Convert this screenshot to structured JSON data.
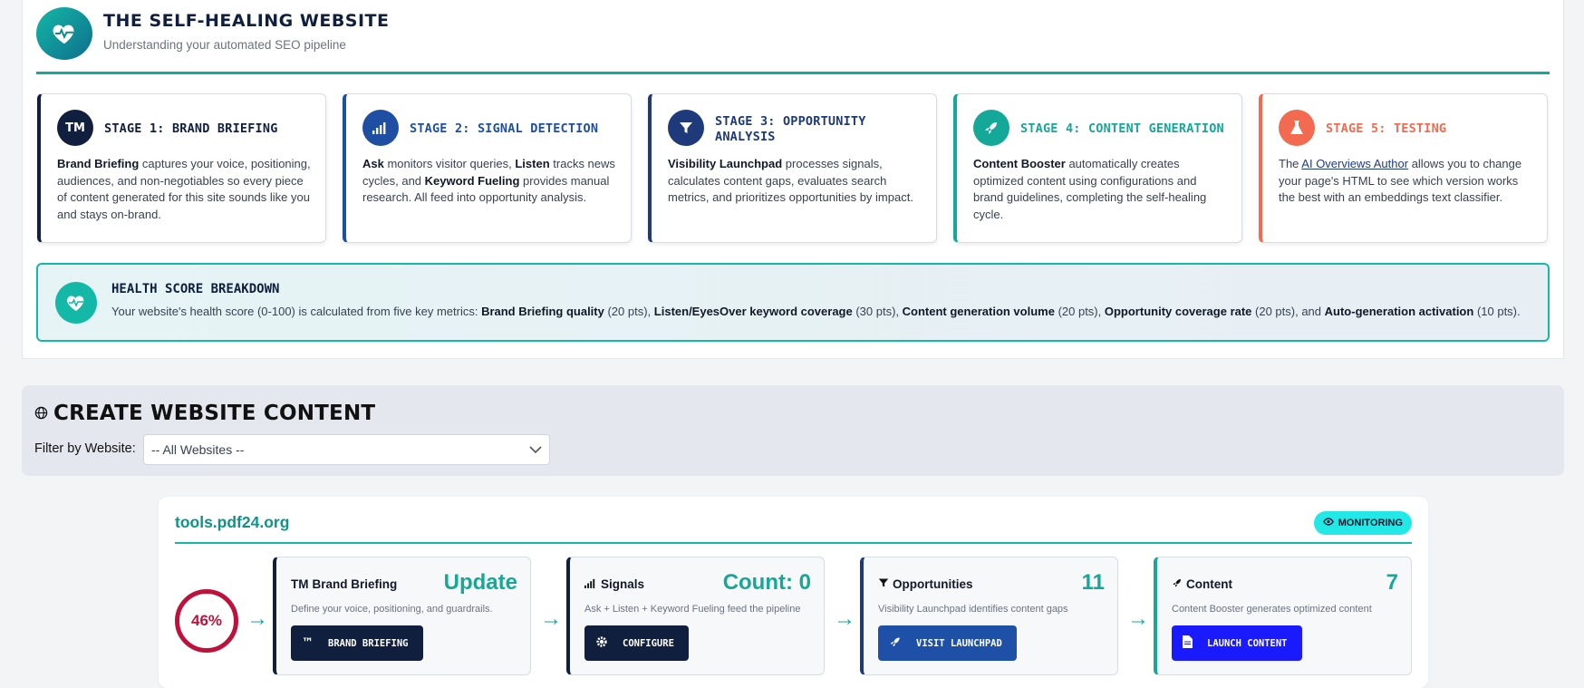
{
  "header": {
    "title": "THE SELF-HEALING WEBSITE",
    "subtitle": "Understanding your automated SEO pipeline",
    "icon": "heart-pulse-icon"
  },
  "stages": [
    {
      "title": "STAGE 1: BRAND BRIEFING",
      "icon_text": "TM",
      "color": "#0f1f3d",
      "title_color": "#0f1f3d",
      "body_html": "<b>Brand Briefing</b> captures your voice, positioning, audiences, and non-negotiables so every piece of content generated for this site sounds like you and stays on-brand."
    },
    {
      "title": "STAGE 2: SIGNAL DETECTION",
      "icon": "signal-bars-icon",
      "color": "#1e4fa3",
      "title_color": "#1e4fa3",
      "body_html": "<b>Ask</b> monitors visitor queries, <b>Listen</b> tracks news cycles, and <b>Keyword Fueling</b> provides manual research. All feed into opportunity analysis."
    },
    {
      "title": "STAGE 3: OPPORTUNITY ANALYSIS",
      "icon": "filter-icon",
      "color": "#1e3a7a",
      "title_color": "#1e3a7a",
      "body_html": "<b>Visibility Launchpad</b> processes signals, calculates content gaps, evaluates search metrics, and prioritizes opportunities by impact."
    },
    {
      "title": "STAGE 4: CONTENT GENERATION",
      "icon": "rocket-icon",
      "color": "#14a898",
      "title_color": "#14a898",
      "body_html": "<b>Content Booster</b> automatically creates optimized content using configurations and brand guidelines, completing the self-healing cycle."
    },
    {
      "title": "STAGE 5: TESTING",
      "icon": "flask-icon",
      "color": "#f26b50",
      "title_color": "#f26b50",
      "body_html": "The <a>AI Overviews Author</a> allows you to change your page's HTML to see which version works the best with an embeddings text classifier."
    }
  ],
  "health": {
    "title": "HEALTH SCORE BREAKDOWN",
    "text_html": "Your website's health score (0-100) is calculated from five key metrics: <b>Brand Briefing quality</b> (20 pts), <b>Listen/EyesOver keyword coverage</b> (30 pts), <b>Content generation volume</b> (20 pts), <b>Opportunity coverage rate</b> (20 pts), and <b>Auto-generation activation</b> (10 pts)."
  },
  "create": {
    "title": "CREATE WEBSITE CONTENT",
    "filter_label": "Filter by Website:",
    "filter_value": "-- All Websites --"
  },
  "site": {
    "name": "tools.pdf24.org",
    "badge": "MONITORING",
    "score": "46%",
    "steps": [
      {
        "name": "Brand Briefing",
        "prefix": "TM",
        "value": "Update",
        "desc": "Define your voice, positioning, and guardrails.",
        "button": "BRAND BRIEFING",
        "btn_color": "#0f1f3d",
        "border": "#0f1f3d"
      },
      {
        "name": "Signals",
        "value": "Count: 0",
        "desc": "Ask + Listen + Keyword Fueling feed the pipeline",
        "button": "CONFIGURE",
        "btn_color": "#0f1f3d",
        "border": "#0f1f3d"
      },
      {
        "name": "Opportunities",
        "value": "11",
        "desc": "Visibility Launchpad identifies content gaps",
        "button": "VISIT LAUNCHPAD",
        "btn_color": "#1e50a8",
        "border": "#1e3a7a"
      },
      {
        "name": "Content",
        "value": "7",
        "desc": "Content Booster generates optimized content",
        "button": "LAUNCH CONTENT",
        "btn_color": "#1a1aff",
        "border": "#14a898"
      }
    ]
  }
}
